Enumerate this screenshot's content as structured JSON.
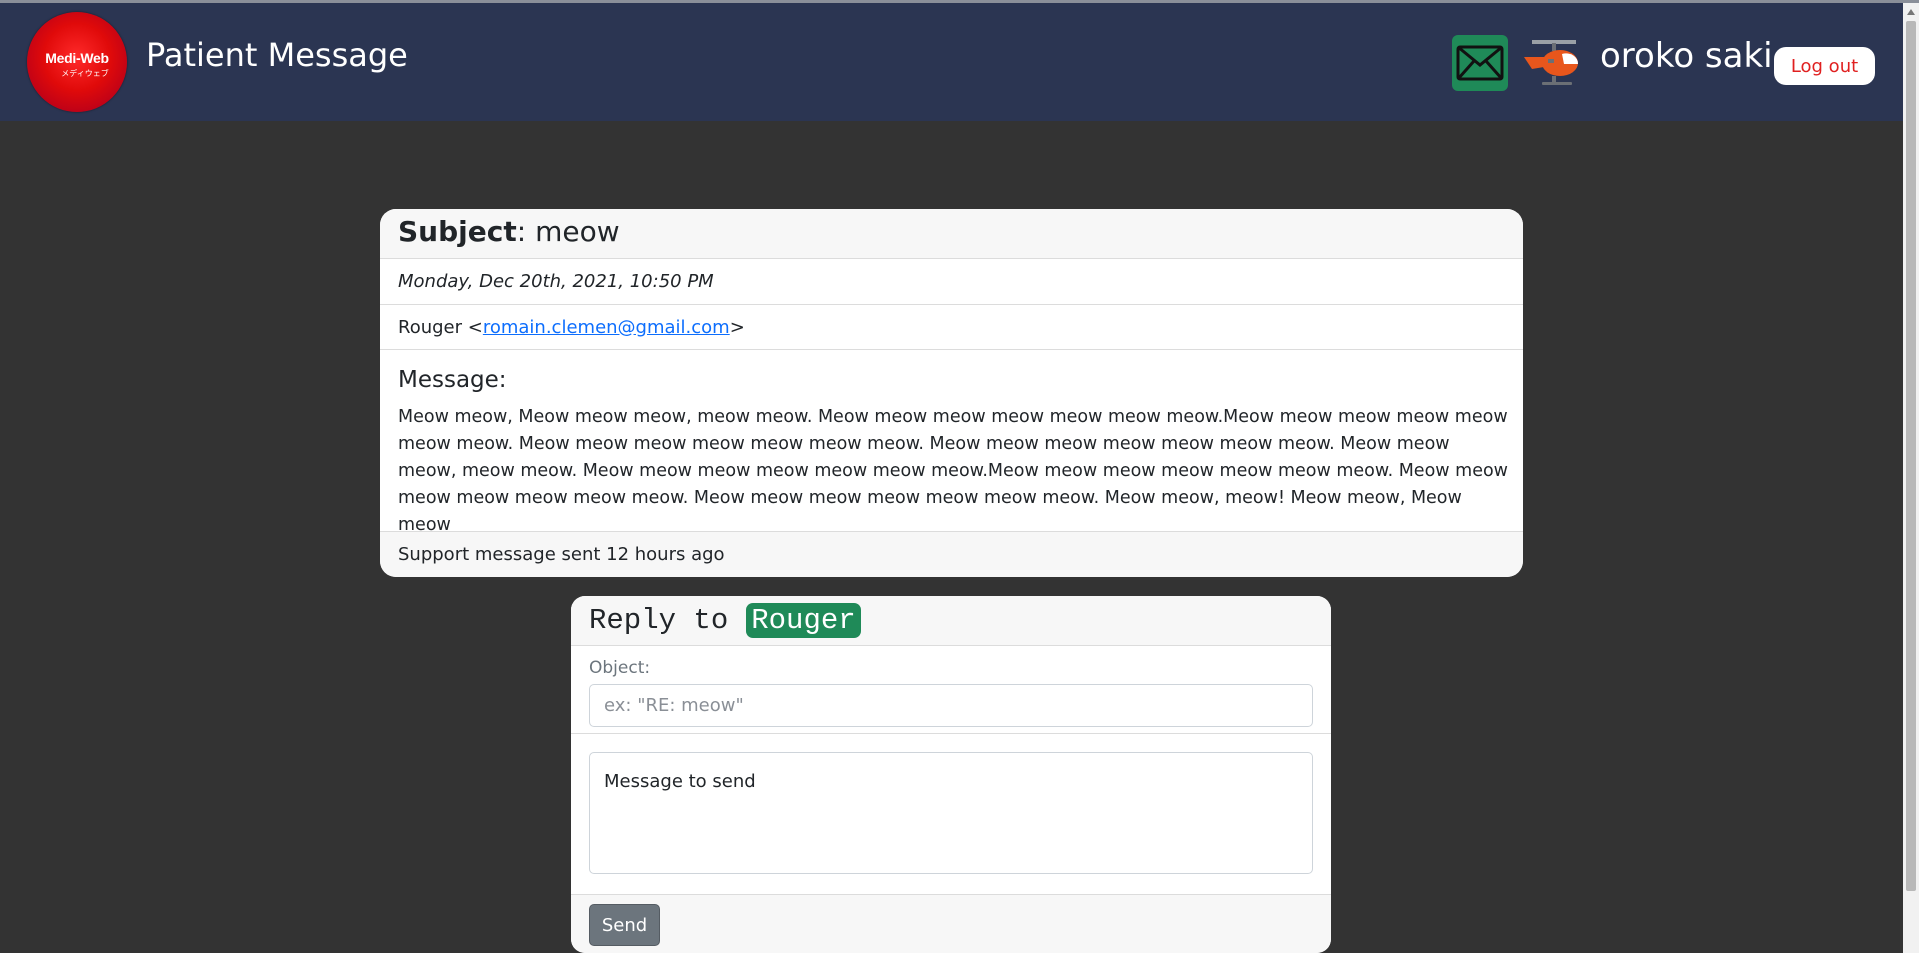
{
  "navbar": {
    "logo_text": "Medi-Web",
    "logo_subtext": "メディウェブ",
    "title": "Patient Message",
    "mail_icon": "envelope-icon",
    "avatar_icon": "helicopter-icon",
    "username": "oroko saki",
    "logout_label": "Log out",
    "colors": {
      "navbar_bg": "#2b3552",
      "logout_text": "#e02020",
      "mail_bg": "#1f8a58"
    }
  },
  "message": {
    "subject_label": "Subject",
    "subject_sep": ": ",
    "subject": "meow",
    "date": "Monday, Dec 20th, 2021, 10:50 PM",
    "from_name": "Rouger ",
    "from_open": "<",
    "from_email": "romain.clemen@gmail.com",
    "from_close": ">",
    "body_title": "Message:",
    "body": "Meow meow, Meow meow meow, meow meow. Meow meow meow meow meow meow meow.Meow meow meow meow meow meow meow. Meow meow meow meow meow meow meow. Meow meow meow meow meow meow meow. Meow meow meow, meow meow. Meow meow meow meow meow meow meow.Meow meow meow meow meow meow meow. Meow meow meow meow meow meow meow. Meow meow meow meow meow meow meow. Meow meow, meow! Meow meow, Meow meow",
    "footer": "Support message sent 12 hours ago"
  },
  "reply": {
    "title": "Reply to",
    "recipient": "Rouger",
    "object_label": "Object:",
    "object_placeholder": "ex: \"RE: meow\"",
    "message_placeholder": "Message to send",
    "send_label": "Send",
    "colors": {
      "recipient_bg": "#1f8a58",
      "send_bg": "#6c757d"
    }
  }
}
